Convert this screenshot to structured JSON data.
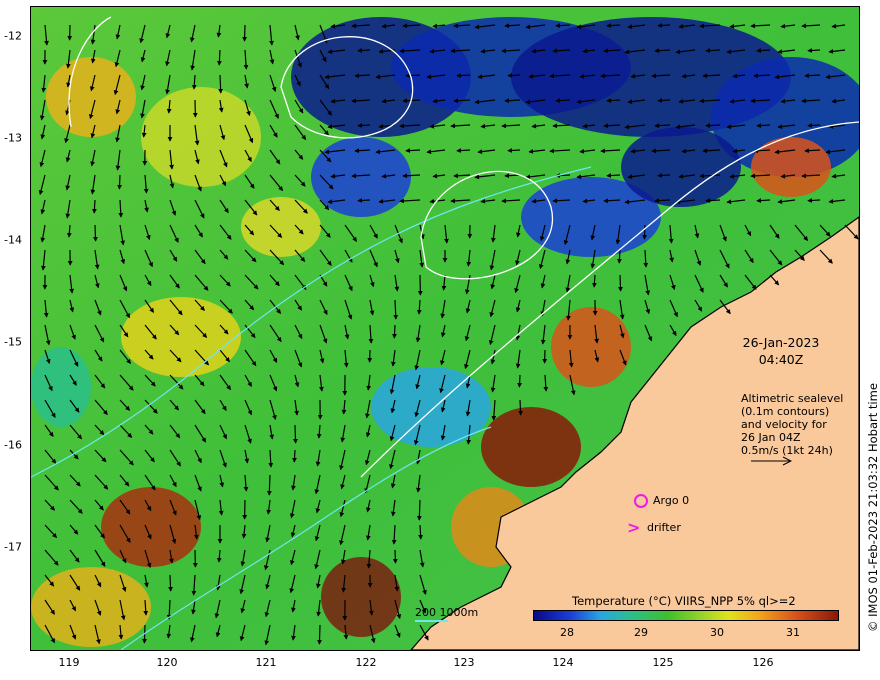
{
  "map": {
    "x_ticks": [
      "119",
      "120",
      "121",
      "122",
      "123",
      "124",
      "125",
      "126"
    ],
    "y_ticks": [
      "-12",
      "-13",
      "-14",
      "-15",
      "-16",
      "-17"
    ],
    "date": "26-Jan-2023",
    "time": "04:40Z",
    "altimetry_lines": [
      "Altimetric sealevel",
      "(0.1m contours)",
      "and velocity for",
      "26 Jan 04Z",
      "0.5m/s (1kt 24h)"
    ],
    "argo_label": "Argo 0",
    "drifter_label": "drifter",
    "scale_label": "200  1000m",
    "colorbar_title": "Temperature (°C) VIIRS_NPP 5% ql>=2",
    "colorbar_ticks": [
      "28",
      "29",
      "30",
      "31"
    ],
    "credit": "© IMOS 01-Feb-2023 21:03:32 Hobart time",
    "colors": {
      "land": "#f9c89b",
      "marker": "#e81ee8",
      "isobath": "#6ee6f0"
    },
    "icons": [
      "argo-float-icon",
      "drifter-icon",
      "velocity-scale-arrow-icon"
    ]
  }
}
